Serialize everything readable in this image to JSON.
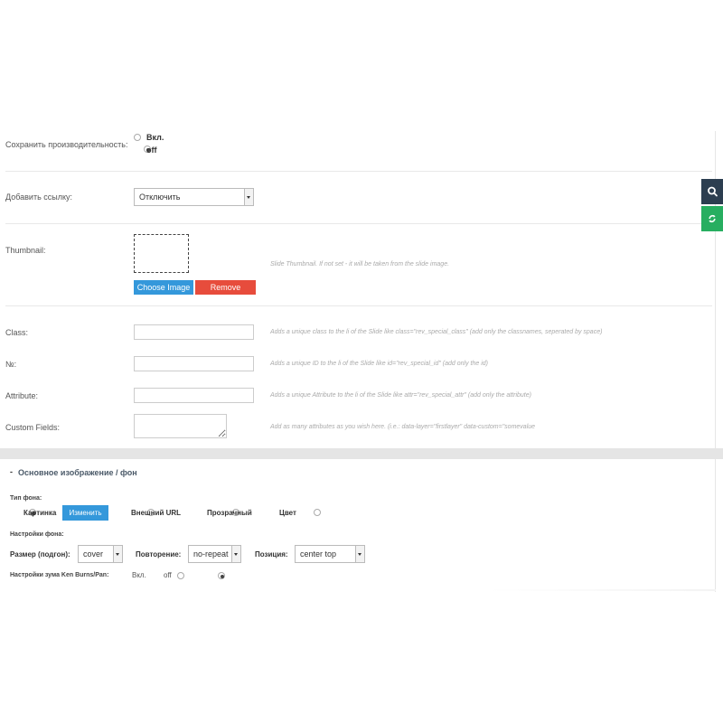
{
  "performance": {
    "label": "Сохранить производительность:",
    "on": "Вкл.",
    "off": "off"
  },
  "add_link": {
    "label": "Добавить ссылку:",
    "value": "Отключить"
  },
  "thumbnail": {
    "label": "Thumbnail:",
    "choose": "Choose Image",
    "remove": "Remove",
    "help": "Slide Thumbnail. If not set - it will be taken from the slide image."
  },
  "class_field": {
    "label": "Class:",
    "help": "Adds a unique class to the li of the Slide like class=\"rev_special_class\" (add only the classnames, seperated by space)"
  },
  "id_field": {
    "label": "№:",
    "help": "Adds a unique ID to the li of the Slide like id=\"rev_special_id\" (add only the id)"
  },
  "attribute_field": {
    "label": "Attribute:",
    "help": "Adds a unique Attribute to the li of the Slide like attr=\"rev_special_attr\" (add only the attribute)"
  },
  "custom_fields": {
    "label": "Custom Fields:",
    "help": "Add as many attributes as you wish here. (i.e.: data-layer=\"firstlayer\" data-custom=\"somevalue"
  },
  "main_image": {
    "title": "Основное изображение / фон",
    "toggle": "-",
    "bg_type_label": "Тип фона:",
    "bg_types": {
      "image": "Картинка",
      "change": "Изменить",
      "external": "Внешний URL",
      "transparent": "Прозрачный",
      "color": "Цвет"
    },
    "bg_settings_label": "Настройки фона:",
    "size_label": "Размер (подгон):",
    "size_value": "cover",
    "repeat_label": "Повторение:",
    "repeat_value": "no-repeat",
    "position_label": "Позиция:",
    "position_value": "center top",
    "kenburns_label": "Настройки зума Ken Burns/Pan:",
    "kenburns_on": "Вкл.",
    "kenburns_off": "off"
  },
  "colors": {
    "blue": "#3498db",
    "red": "#e74c3c",
    "dark": "#2c3e50",
    "green": "#27ae60"
  }
}
